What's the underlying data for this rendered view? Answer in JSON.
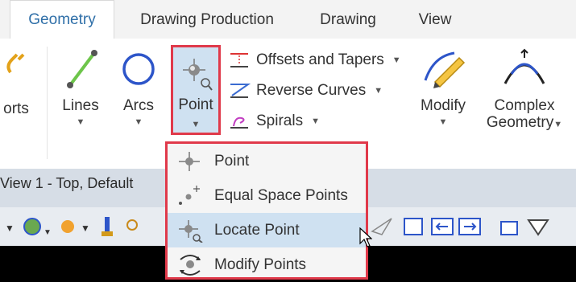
{
  "tabs": [
    {
      "label": "Geometry",
      "active": true
    },
    {
      "label": "Drawing Production",
      "active": false
    },
    {
      "label": "Drawing",
      "active": false
    },
    {
      "label": "View",
      "active": false
    }
  ],
  "ribbon": {
    "partial_label": "orts",
    "lines_label": "Lines",
    "arcs_label": "Arcs",
    "point_label": "Point",
    "offsets_label": "Offsets and Tapers",
    "reverse_label": "Reverse Curves",
    "spirals_label": "Spirals",
    "modify_label": "Modify",
    "complex_line1": "Complex",
    "complex_line2": "Geometry",
    "caret": "▼"
  },
  "view": {
    "title": "View 1 - Top, Default"
  },
  "menu": {
    "items": [
      {
        "label": "Point",
        "icon": "point-icon"
      },
      {
        "label": "Equal Space Points",
        "icon": "equal-space-points-icon"
      },
      {
        "label": "Locate Point",
        "icon": "locate-point-icon",
        "hover": true
      },
      {
        "label": "Modify Points",
        "icon": "modify-points-icon"
      }
    ]
  },
  "colors": {
    "accent_tab": "#2f6fa8",
    "highlight": "#cfe1f1",
    "outline_red": "#e0394a"
  }
}
